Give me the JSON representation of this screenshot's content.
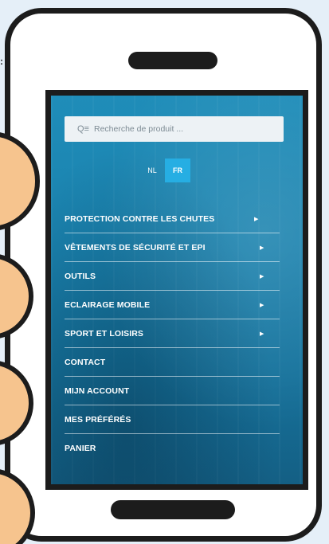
{
  "search": {
    "placeholder": "Recherche de produit ..."
  },
  "languages": [
    {
      "label": "NL",
      "active": false
    },
    {
      "label": "FR",
      "active": true
    }
  ],
  "menu": [
    {
      "label": "PROTECTION CONTRE LES CHUTES",
      "has_submenu": true
    },
    {
      "label": "VÊTEMENTS DE SÉCURITÉ ET EPI",
      "has_submenu": true
    },
    {
      "label": "OUTILS",
      "has_submenu": true
    },
    {
      "label": "ECLAIRAGE MOBILE",
      "has_submenu": true
    },
    {
      "label": "SPORT ET LOISIRS",
      "has_submenu": true
    },
    {
      "label": "CONTACT",
      "has_submenu": false
    },
    {
      "label": "MIJN ACCOUNT",
      "has_submenu": false
    },
    {
      "label": "MES PRÉFÉRÉS",
      "has_submenu": false
    },
    {
      "label": "PANIER",
      "has_submenu": false
    }
  ],
  "colors": {
    "screen_background": "#1a81ad",
    "active_language": "#26aee3",
    "finger": "#f6c48e",
    "phone_frame": "#1c1c1c"
  }
}
